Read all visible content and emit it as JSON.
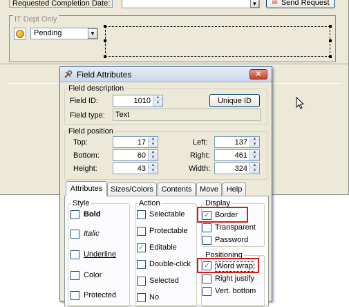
{
  "form": {
    "requested_label": "Requested Completion Date:",
    "send_button": "Send Request",
    "it_dept_label": "IT Dept Only",
    "status_value": "Pending"
  },
  "dialog": {
    "title": "Field Attributes",
    "close_glyph": "✕",
    "field_description": {
      "legend": "Field description",
      "field_id_label": "Field ID:",
      "field_id_value": "1010",
      "unique_id_button": "Unique ID",
      "field_type_label": "Field type:",
      "field_type_value": "Text"
    },
    "field_position": {
      "legend": "Field position",
      "top_label": "Top:",
      "top_value": "17",
      "bottom_label": "Bottom:",
      "bottom_value": "60",
      "height_label": "Height:",
      "height_value": "43",
      "left_label": "Left:",
      "left_value": "137",
      "right_label": "Right:",
      "right_value": "461",
      "width_label": "Width:",
      "width_value": "324"
    },
    "tabs": [
      "Attributes",
      "Sizes/Colors",
      "Contents",
      "Move",
      "Help"
    ],
    "style": {
      "legend": "Style",
      "items": [
        "Bold",
        "Italic",
        "Underline",
        "Color",
        "Protected"
      ]
    },
    "action": {
      "legend": "Action",
      "items": [
        "Selectable",
        "Protectable",
        "Editable",
        "Double-click",
        "Selected",
        "No"
      ]
    },
    "display": {
      "legend": "Display",
      "items": [
        "Border",
        "Transparent",
        "Password"
      ]
    },
    "positioning": {
      "legend": "Positioning",
      "items": [
        "Word wrap",
        "Right justify",
        "Vert. bottom"
      ]
    },
    "check_glyph": "✓"
  },
  "colors": {
    "highlight": "#d11a1a",
    "title_gradient_top": "#e8edf5",
    "bg": "#ece9d8"
  }
}
